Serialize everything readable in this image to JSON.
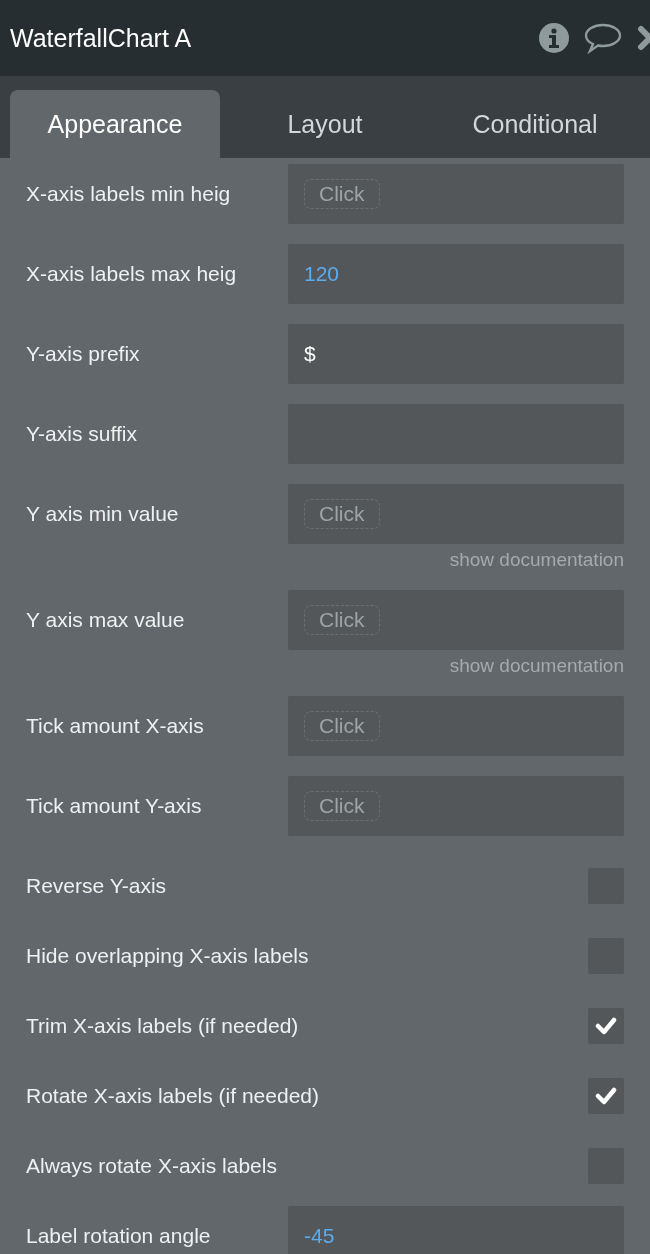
{
  "window": {
    "title": "WaterfallChart A"
  },
  "tabs": [
    {
      "label": "Appearance",
      "selected": true
    },
    {
      "label": "Layout",
      "selected": false
    },
    {
      "label": "Conditional",
      "selected": false
    }
  ],
  "properties": [
    {
      "kind": "field",
      "label": "X-axis labels min heig",
      "button": "Click"
    },
    {
      "kind": "field",
      "label": "X-axis labels max heig",
      "value": "120",
      "numeric": true
    },
    {
      "kind": "field",
      "label": "Y-axis prefix",
      "value": "$",
      "numeric": false
    },
    {
      "kind": "field",
      "label": "Y-axis suffix"
    },
    {
      "kind": "field",
      "label": "Y axis min value",
      "button": "Click",
      "doc_link": "show documentation"
    },
    {
      "kind": "field",
      "label": "Y axis max value",
      "button": "Click",
      "doc_link": "show documentation"
    },
    {
      "kind": "field",
      "label": "Tick amount X-axis",
      "button": "Click"
    },
    {
      "kind": "field",
      "label": "Tick amount Y-axis",
      "button": "Click"
    },
    {
      "kind": "checkbox",
      "label": "Reverse Y-axis",
      "checked": false
    },
    {
      "kind": "checkbox",
      "label": "Hide overlapping X-axis labels",
      "checked": false
    },
    {
      "kind": "checkbox",
      "label": "Trim X-axis labels (if needed)",
      "checked": true
    },
    {
      "kind": "checkbox",
      "label": "Rotate X-axis labels (if needed)",
      "checked": true
    },
    {
      "kind": "checkbox",
      "label": "Always rotate X-axis labels",
      "checked": false
    },
    {
      "kind": "field",
      "label": "Label rotation angle",
      "value": "-45",
      "numeric": true
    }
  ]
}
